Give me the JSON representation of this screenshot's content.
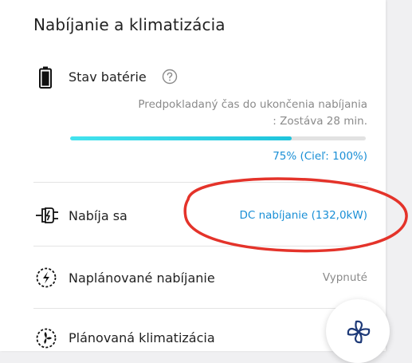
{
  "title": "Nabíjanie a klimatizácia",
  "battery": {
    "label": "Stav batérie",
    "estimate_line1": "Predpokladaný čas do ukončenia nabíjania",
    "estimate_line2": ": Zostáva 28 min.",
    "progress_fraction": 0.75,
    "percent_text": "75% (Cieľ: 100%)"
  },
  "rows": [
    {
      "label": "Nabíja sa",
      "value": "DC nabíjanie (132,0kW)"
    },
    {
      "label": "Naplánované nabíjanie",
      "value": "Vypnuté"
    },
    {
      "label": "Plánovaná klimatizácia"
    }
  ],
  "colors": {
    "accent": "#1a8fd6",
    "progress": "#2fd3e6",
    "annotation": "#e4332a",
    "fan": "#1e3a78"
  },
  "icons": [
    "battery-icon",
    "help-icon",
    "charging-plug-icon",
    "scheduled-charging-icon",
    "scheduled-climate-icon",
    "fan-icon"
  ]
}
